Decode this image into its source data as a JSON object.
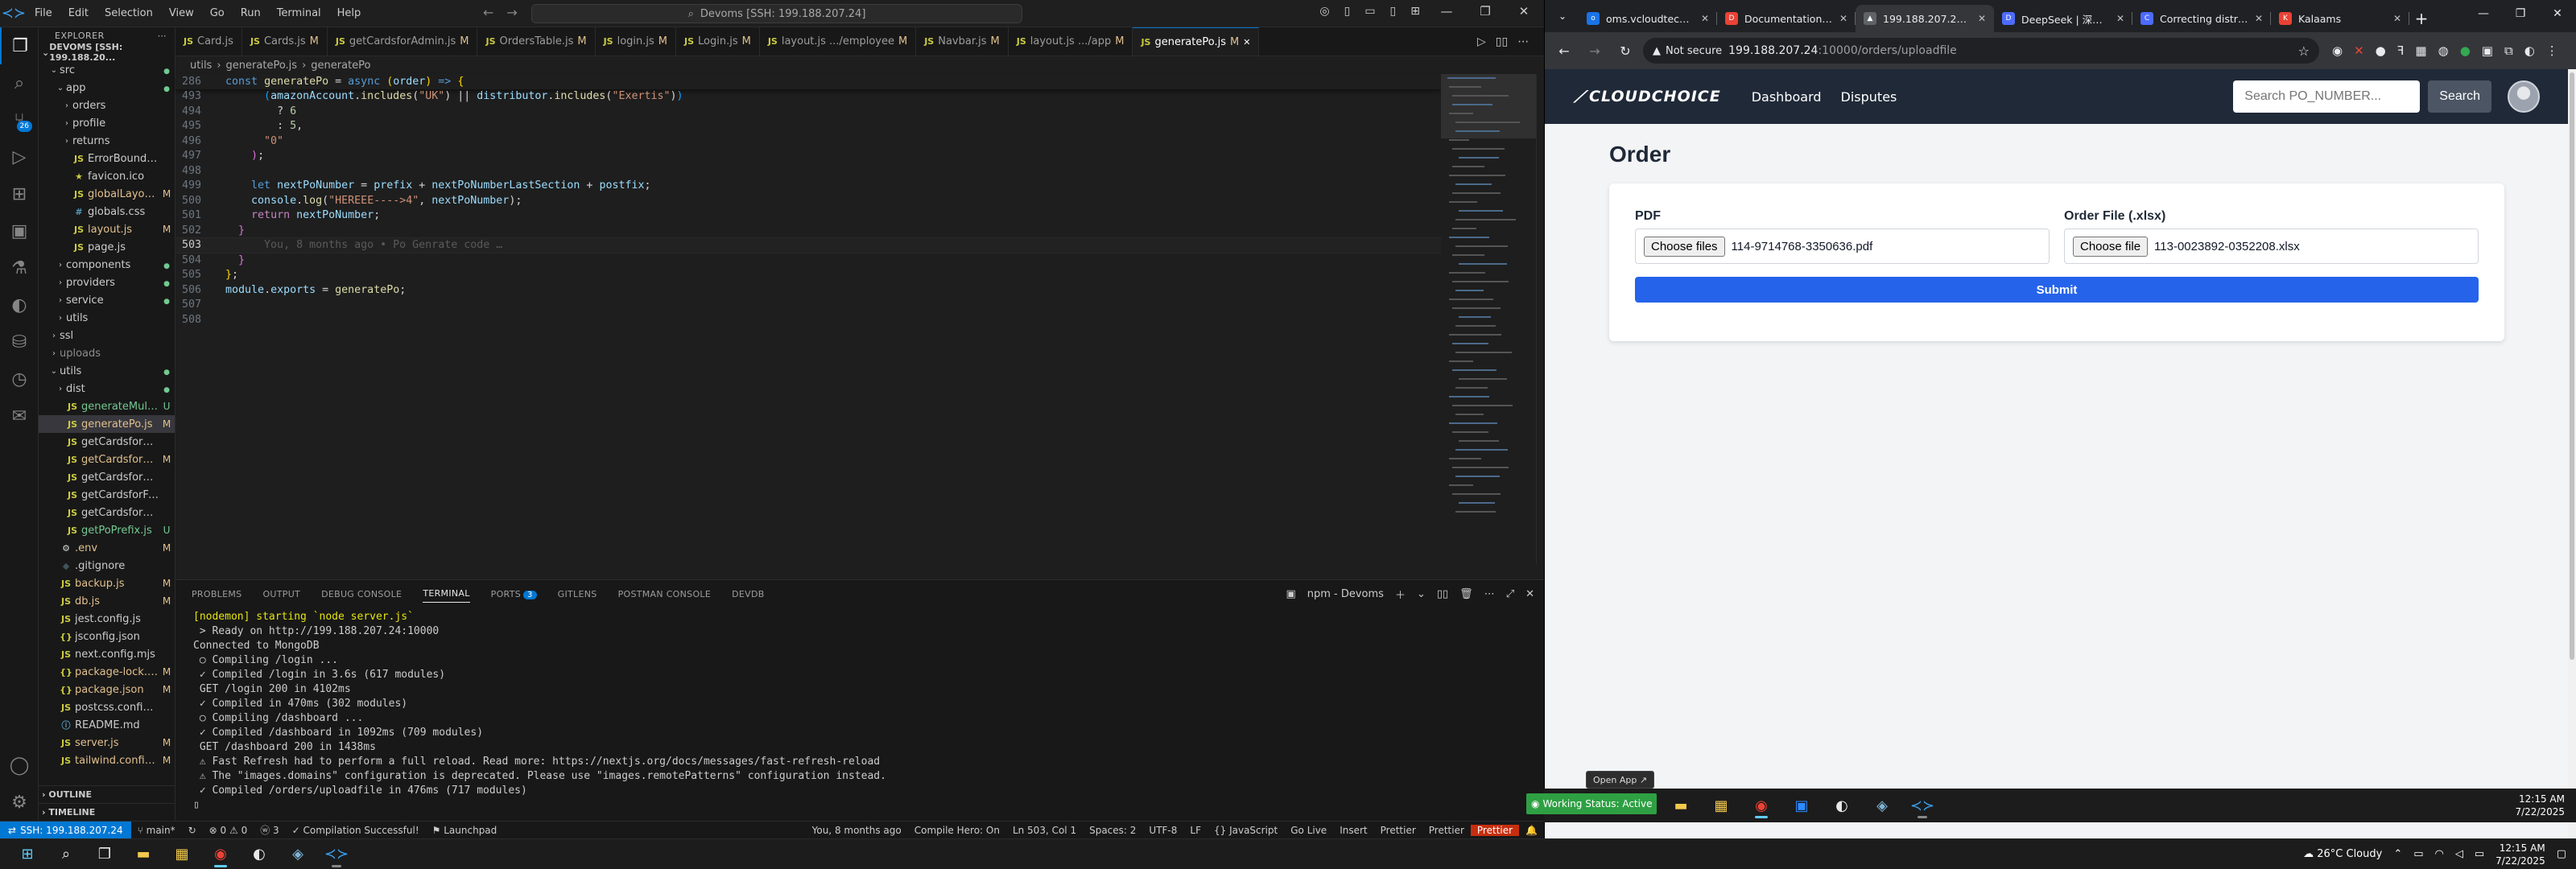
{
  "vscode": {
    "menu": [
      "File",
      "Edit",
      "Selection",
      "View",
      "Go",
      "Run",
      "Terminal",
      "Help"
    ],
    "command_center": "Devoms [SSH: 199.188.207.24]",
    "explorer": {
      "header": "EXPLORER",
      "root": "DEVOMS [SSH: 199.188.20...",
      "tree": [
        {
          "name": "src",
          "depth": 1,
          "kind": "folder-open",
          "status": "dot-green"
        },
        {
          "name": "app",
          "depth": 2,
          "kind": "folder-open",
          "status": "dot-green"
        },
        {
          "name": "orders",
          "depth": 3,
          "kind": "folder",
          "status": ""
        },
        {
          "name": "profile",
          "depth": 3,
          "kind": "folder",
          "status": ""
        },
        {
          "name": "returns",
          "depth": 3,
          "kind": "folder",
          "status": ""
        },
        {
          "name": "ErrorBoundary.js",
          "depth": 3,
          "kind": "js",
          "status": ""
        },
        {
          "name": "favicon.ico",
          "depth": 3,
          "kind": "ico",
          "status": ""
        },
        {
          "name": "globalLayout.js",
          "depth": 3,
          "kind": "js",
          "status": "M"
        },
        {
          "name": "globals.css",
          "depth": 3,
          "kind": "css",
          "status": ""
        },
        {
          "name": "layout.js",
          "depth": 3,
          "kind": "js",
          "status": "M"
        },
        {
          "name": "page.js",
          "depth": 3,
          "kind": "js",
          "status": ""
        },
        {
          "name": "components",
          "depth": 2,
          "kind": "folder",
          "status": "dot-green"
        },
        {
          "name": "providers",
          "depth": 2,
          "kind": "folder",
          "status": "dot-green"
        },
        {
          "name": "service",
          "depth": 2,
          "kind": "folder",
          "status": "dot-green"
        },
        {
          "name": "utils",
          "depth": 2,
          "kind": "folder",
          "status": ""
        },
        {
          "name": "ssl",
          "depth": 1,
          "kind": "folder",
          "status": ""
        },
        {
          "name": "uploads",
          "depth": 1,
          "kind": "folder",
          "status": "",
          "dim": true
        },
        {
          "name": "utils",
          "depth": 1,
          "kind": "folder-open",
          "status": "dot-green"
        },
        {
          "name": "dist",
          "depth": 2,
          "kind": "folder",
          "status": "dot-green"
        },
        {
          "name": "generateMulti...",
          "depth": 2,
          "kind": "js",
          "status": "U"
        },
        {
          "name": "generatePo.js",
          "depth": 2,
          "kind": "js",
          "status": "M",
          "selected": true
        },
        {
          "name": "getCardsforAccount.js",
          "depth": 2,
          "kind": "js",
          "status": ""
        },
        {
          "name": "getCardsforAd...",
          "depth": 2,
          "kind": "js",
          "status": "M"
        },
        {
          "name": "getCardsforAmazon.js",
          "depth": 2,
          "kind": "js",
          "status": ""
        },
        {
          "name": "getCardsforFinance.js",
          "depth": 2,
          "kind": "js",
          "status": ""
        },
        {
          "name": "getCardsforPurchasi...",
          "depth": 2,
          "kind": "js",
          "status": ""
        },
        {
          "name": "getPoPrefix.js",
          "depth": 2,
          "kind": "js",
          "status": "U"
        },
        {
          "name": ".env",
          "depth": 1,
          "kind": "env",
          "status": "M"
        },
        {
          "name": ".gitignore",
          "depth": 1,
          "kind": "git",
          "status": ""
        },
        {
          "name": "backup.js",
          "depth": 1,
          "kind": "js",
          "status": "M"
        },
        {
          "name": "db.js",
          "depth": 1,
          "kind": "js",
          "status": "M"
        },
        {
          "name": "jest.config.js",
          "depth": 1,
          "kind": "js",
          "status": ""
        },
        {
          "name": "jsconfig.json",
          "depth": 1,
          "kind": "json",
          "status": ""
        },
        {
          "name": "next.config.mjs",
          "depth": 1,
          "kind": "js",
          "status": ""
        },
        {
          "name": "package-lock.json",
          "depth": 1,
          "kind": "json",
          "status": "M"
        },
        {
          "name": "package.json",
          "depth": 1,
          "kind": "json",
          "status": "M"
        },
        {
          "name": "postcss.config.mjs",
          "depth": 1,
          "kind": "js",
          "status": ""
        },
        {
          "name": "README.md",
          "depth": 1,
          "kind": "md",
          "status": ""
        },
        {
          "name": "server.js",
          "depth": 1,
          "kind": "js",
          "status": "M"
        },
        {
          "name": "tailwind.config.js",
          "depth": 1,
          "kind": "js",
          "status": "M"
        }
      ],
      "outline": "OUTLINE",
      "timeline": "TIMELINE"
    },
    "tabs": [
      {
        "label": "Card.js",
        "mod": ""
      },
      {
        "label": "Cards.js",
        "mod": "M"
      },
      {
        "label": "getCardsforAdmin.js",
        "mod": "M"
      },
      {
        "label": "OrdersTable.js",
        "mod": "M"
      },
      {
        "label": "login.js",
        "mod": "M"
      },
      {
        "label": "Login.js",
        "mod": "M"
      },
      {
        "label": "layout.js .../employee",
        "mod": "M"
      },
      {
        "label": "Navbar.js",
        "mod": "M"
      },
      {
        "label": "layout.js .../app",
        "mod": "M"
      },
      {
        "label": "generatePo.js",
        "mod": "M",
        "active": true
      }
    ],
    "breadcrumb": [
      "utils",
      "generatePo.js",
      "generatePo"
    ],
    "code": [
      {
        "n": "286",
        "html": "<span class='kw'>const</span> <span class='fn'>generatePo</span> <span class='pu'>=</span> <span class='kw'>async</span> <span class='br1'>(</span><span class='vr'>order</span><span class='br1'>)</span> <span class='kw'>=&gt;</span> <span class='br1'>{</span>",
        "sticky": true
      },
      {
        "n": "493",
        "html": "      <span class='br3'>(</span><span class='vr'>amazonAccount</span>.<span class='fn'>includes</span>(<span class='st2'>\"UK\"</span>) <span class='pu'>||</span> <span class='vr'>distributor</span>.<span class='fn'>includes</span>(<span class='st2'>\"Exertis\"</span>)<span class='br3'>)</span>"
      },
      {
        "n": "494",
        "html": "        <span class='pu'>?</span> <span class='nu'>6</span>"
      },
      {
        "n": "495",
        "html": "        <span class='pu'>:</span> <span class='nu'>5</span>,"
      },
      {
        "n": "496",
        "html": "      <span class='st2'>\"0\"</span>"
      },
      {
        "n": "497",
        "html": "    <span class='br2'>)</span>;"
      },
      {
        "n": "498",
        "html": ""
      },
      {
        "n": "499",
        "html": "    <span class='kw'>let</span> <span class='vr'>nextPoNumber</span> = <span class='vr'>prefix</span> + <span class='vr'>nextPoNumberLastSection</span> + <span class='vr'>postfix</span>;"
      },
      {
        "n": "500",
        "html": "    <span class='vr'>console</span>.<span class='fn'>log</span>(<span class='st2'>\"HEREEE----&gt;4\"</span>, <span class='vr'>nextPoNumber</span>);"
      },
      {
        "n": "501",
        "html": "    <span class='cl'>return</span> <span class='vr'>nextPoNumber</span>;"
      },
      {
        "n": "502",
        "html": "  <span class='br2'>}</span>"
      },
      {
        "n": "503",
        "html": "      <span class='ghost'>You, 8 months ago • Po Genrate code …</span>",
        "current": true
      },
      {
        "n": "504",
        "html": "  <span class='br2'>}</span>"
      },
      {
        "n": "505",
        "html": "<span class='br1'>}</span>;"
      },
      {
        "n": "506",
        "html": "<span class='vr'>module</span>.<span class='vr'>exports</span> = <span class='fn'>generatePo</span>;"
      },
      {
        "n": "507",
        "html": ""
      },
      {
        "n": "508",
        "html": ""
      }
    ],
    "panel": {
      "tabs": [
        "PROBLEMS",
        "OUTPUT",
        "DEBUG CONSOLE",
        "TERMINAL",
        "PORTS",
        "GITLENS",
        "POSTMAN CONSOLE",
        "DEVDB"
      ],
      "ports_badge": "3",
      "terminal_name": "npm - Devoms",
      "lines": [
        {
          "c": "t-yel",
          "t": "[nodemon] starting `node server.js`"
        },
        {
          "c": "",
          "t": " > Ready on http://199.188.207.24:10000"
        },
        {
          "c": "",
          "t": "Connected to MongoDB"
        },
        {
          "c": "",
          "t": " ○ Compiling /login ..."
        },
        {
          "c": "",
          "t": " ✓ Compiled /login in 3.6s (617 modules)"
        },
        {
          "c": "",
          "t": " GET /login 200 in 4102ms"
        },
        {
          "c": "",
          "t": " ✓ Compiled in 470ms (302 modules)"
        },
        {
          "c": "",
          "t": " ○ Compiling /dashboard ..."
        },
        {
          "c": "",
          "t": " ✓ Compiled /dashboard in 1092ms (709 modules)"
        },
        {
          "c": "",
          "t": " GET /dashboard 200 in 1438ms"
        },
        {
          "c": "",
          "t": " ⚠ Fast Refresh had to perform a full reload. Read more: https://nextjs.org/docs/messages/fast-refresh-reload"
        },
        {
          "c": "",
          "t": " ⚠ The \"images.domains\" configuration is deprecated. Please use \"images.remotePatterns\" configuration instead."
        },
        {
          "c": "",
          "t": " ✓ Compiled /orders/uploadfile in 476ms (717 modules)"
        },
        {
          "c": "",
          "t": "▯"
        }
      ]
    },
    "status": {
      "remote": "SSH: 199.188.207.24",
      "branch": "main*",
      "sync": "↻",
      "errors": "⊗ 0 ⚠ 0",
      "ports": "ⓦ 3",
      "compile_msg": "✓ Compilation Successful!",
      "launchpad": "Launchpad",
      "blame": "You, 8 months ago",
      "compile_hero": "Compile Hero: On",
      "cursor": "Ln 503, Col 1",
      "spaces": "Spaces: 2",
      "encoding": "UTF-8",
      "eol": "LF",
      "language": "{} JavaScript",
      "golive": "Go Live",
      "insert": "Insert",
      "prettier1": "Prettier",
      "prettier2": "Prettier",
      "prettier3": "Prettier"
    }
  },
  "chrome": {
    "tabs": [
      {
        "label": "oms.vcloudtech.c...",
        "fav": "#1a73e8",
        "favtxt": "o"
      },
      {
        "label": "Documentation | ...",
        "fav": "#e94235",
        "favtxt": "D"
      },
      {
        "label": "199.188.207.24:10...",
        "fav": "#5f6368",
        "favtxt": "▲",
        "active": true
      },
      {
        "label": "DeepSeek | 深度求...",
        "fav": "#4d6bfe",
        "favtxt": "D"
      },
      {
        "label": "Correcting distrib...",
        "fav": "#4d6bfe",
        "favtxt": "C"
      },
      {
        "label": "Kalaams",
        "fav": "#e94235",
        "favtxt": "K"
      }
    ],
    "omnibox": {
      "security": "Not secure",
      "host": "199.188.207.24",
      "path": ":10000/orders/uploadfile"
    }
  },
  "app": {
    "brand": "CLOUDCHOICE",
    "nav": [
      "Dashboard",
      "Disputes"
    ],
    "search_placeholder": "Search PO_NUMBER...",
    "search_button": "Search",
    "page_title": "Order",
    "pdf_label": "PDF",
    "pdf_button": "Choose files",
    "pdf_file": "114-9714768-3350636.pdf",
    "xlsx_label": "Order File (.xlsx)",
    "xlsx_button": "Choose file",
    "xlsx_file": "113-0023892-0352208.xlsx",
    "submit": "Submit"
  },
  "taskbar": {
    "weather": "26°C  Cloudy",
    "time": "12:15 AM",
    "date": "7/22/2025",
    "working_status": "Working Status: Active",
    "open_app": "Open App ↗"
  }
}
